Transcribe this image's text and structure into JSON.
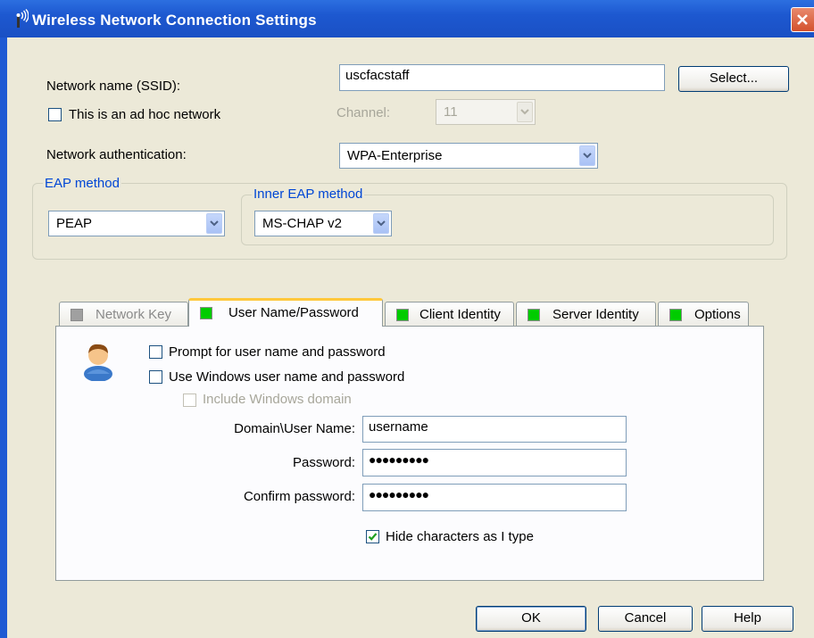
{
  "window": {
    "title": "Wireless Network Connection Settings"
  },
  "network": {
    "ssid_label": "Network name (SSID):",
    "ssid_value": "uscfacstaff",
    "select_button": "Select...",
    "adhoc_label": "This is an ad hoc network",
    "channel_label": "Channel:",
    "channel_value": "11",
    "auth_label": "Network authentication:",
    "auth_value": "WPA-Enterprise"
  },
  "eap": {
    "group_title": "EAP method",
    "method_value": "PEAP",
    "inner_title": "Inner EAP method",
    "inner_value": "MS-CHAP v2"
  },
  "tabs": [
    {
      "label": "Network Key",
      "color": "#a0a0a0",
      "enabled": false
    },
    {
      "label": "User Name/Password",
      "color": "#00cc00",
      "active": true
    },
    {
      "label": "Client Identity",
      "color": "#00cc00"
    },
    {
      "label": "Server Identity",
      "color": "#00cc00"
    },
    {
      "label": "Options",
      "color": "#00cc00"
    }
  ],
  "credentials": {
    "prompt_label": "Prompt for user name and password",
    "use_windows_label": "Use Windows user name and password",
    "include_domain_label": "Include Windows domain",
    "username_label": "Domain\\User Name:",
    "username_value": "username",
    "password_label": "Password:",
    "password_value": "●●●●●●●●●",
    "confirm_label": "Confirm password:",
    "confirm_value": "●●●●●●●●●",
    "hide_chars_label": "Hide characters as I type",
    "hide_chars_checked": true
  },
  "buttons": {
    "ok": "OK",
    "cancel": "Cancel",
    "help": "Help"
  },
  "icons": {
    "title": "wireless-antenna-icon",
    "user": "user-icon",
    "close": "close-icon",
    "dropdown": "chevron-down-icon"
  }
}
